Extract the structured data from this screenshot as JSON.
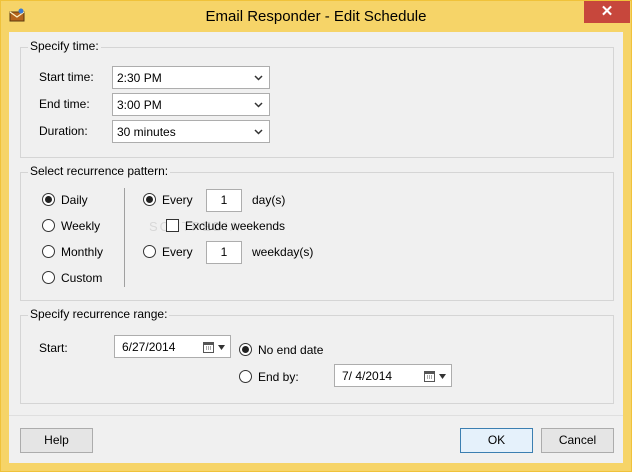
{
  "window": {
    "title": "Email Responder - Edit Schedule",
    "close_glyph": "✕"
  },
  "specify_time": {
    "title": "Specify time:",
    "start_label": "Start time:",
    "start_value": "2:30 PM",
    "end_label": "End time:",
    "end_value": "3:00 PM",
    "duration_label": "Duration:",
    "duration_value": "30 minutes"
  },
  "recurrence": {
    "title": "Select recurrence pattern:",
    "options": [
      {
        "label": "Daily",
        "selected": true
      },
      {
        "label": "Weekly",
        "selected": false
      },
      {
        "label": "Monthly",
        "selected": false
      },
      {
        "label": "Custom",
        "selected": false
      }
    ],
    "every_label": "Every",
    "every_value": "1",
    "every_unit": "day(s)",
    "exclude_weekends_label": "Exclude weekends",
    "exclude_weekends_checked": false,
    "every_weekday_label": "Every",
    "every_weekday_value": "1",
    "every_weekday_unit": "weekday(s)",
    "watermark": "SOFTPEDIA"
  },
  "range": {
    "title": "Specify recurrence range:",
    "start_label": "Start:",
    "start_value": "6/27/2014",
    "no_end_label": "No end date",
    "end_by_label": "End by:",
    "end_by_value": "7/ 4/2014"
  },
  "buttons": {
    "help": "Help",
    "ok": "OK",
    "cancel": "Cancel"
  }
}
